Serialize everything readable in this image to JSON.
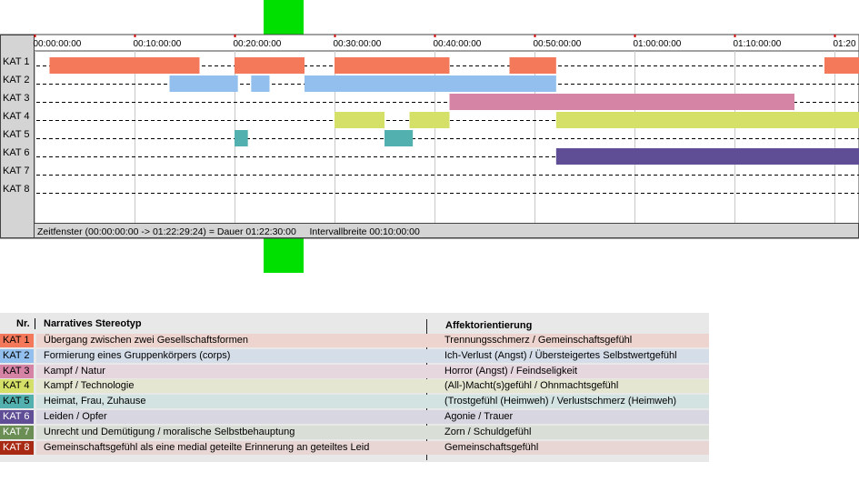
{
  "chart_data": {
    "type": "gantt",
    "x_unit": "seconds",
    "x_range": [
      0,
      4950
    ],
    "tick_interval": 600,
    "tick_labels": [
      "00:00:00:00",
      "00:10:00:00",
      "00:20:00:00",
      "00:30:00:00",
      "00:40:00:00",
      "00:50:00:00",
      "01:00:00:00",
      "01:10:00:00",
      "01:20"
    ],
    "categories": [
      "KAT 1",
      "KAT 2",
      "KAT 3",
      "KAT 4",
      "KAT 5",
      "KAT 6",
      "KAT 7",
      "KAT 8"
    ],
    "colors": [
      "#f4795a",
      "#92bfee",
      "#d584a6",
      "#d4e067",
      "#52b0ae",
      "#5f4e96",
      "#6b8e55",
      "#a82a14"
    ],
    "series": [
      {
        "category": "KAT 1",
        "segments": [
          [
            90,
            990
          ],
          [
            1200,
            1620
          ],
          [
            1800,
            2490
          ],
          [
            2850,
            3130
          ],
          [
            4740,
            4950
          ]
        ]
      },
      {
        "category": "KAT 2",
        "segments": [
          [
            810,
            1220
          ],
          [
            1300,
            1410
          ],
          [
            1620,
            3130
          ]
        ]
      },
      {
        "category": "KAT 3",
        "segments": [
          [
            2490,
            4560
          ]
        ]
      },
      {
        "category": "KAT 4",
        "segments": [
          [
            1800,
            2100
          ],
          [
            2250,
            2490
          ],
          [
            3130,
            4950
          ]
        ]
      },
      {
        "category": "KAT 5",
        "segments": [
          [
            1200,
            1280
          ],
          [
            2100,
            2270
          ]
        ]
      },
      {
        "category": "KAT 6",
        "segments": [
          [
            3130,
            4950
          ]
        ]
      },
      {
        "category": "KAT 7",
        "segments": []
      },
      {
        "category": "KAT 8",
        "segments": []
      }
    ],
    "status_text": "Zeitfenster (00:00:00:00 -> 01:22:29:24) = Dauer 01:22:30:00     Intervallbreite 00:10:00:00"
  },
  "legend": {
    "header_nr": "Nr.",
    "header_stereotyp": "Narratives Stereotyp",
    "header_affekt": "Affektorientierung",
    "rows": [
      {
        "code": "KAT 1",
        "color": "#f4795a",
        "rowbg": "#eed4ce",
        "stereotyp": "Übergang zwischen zwei Gesellschaftsformen",
        "affekt": "Trennungsschmerz / Gemeinschaftsgefühl"
      },
      {
        "code": "KAT 2",
        "color": "#92bfee",
        "rowbg": "#d5dde8",
        "stereotyp": "Formierung eines Gruppenkörpers (corps)",
        "affekt": "Ich-Verlust (Angst) / Übersteigertes Selbstwertgefühl"
      },
      {
        "code": "KAT 3",
        "color": "#d584a6",
        "rowbg": "#e6d6dd",
        "stereotyp": "Kampf / Natur",
        "affekt": "Horror (Angst) / Feindseligkeit"
      },
      {
        "code": "KAT 4",
        "color": "#d4e067",
        "rowbg": "#e4e6d2",
        "stereotyp": "Kampf / Technologie",
        "affekt": "(All-)Macht(s)gefühl / Ohnmachtsgefühl"
      },
      {
        "code": "KAT 5",
        "color": "#52b0ae",
        "rowbg": "#d2e3e2",
        "stereotyp": "Heimat, Frau, Zuhause",
        "affekt": "(Trostgefühl (Heimweh) / Verlustschmerz (Heimweh)"
      },
      {
        "code": "KAT 6",
        "color": "#5f4e96",
        "rowbg": "#d8d6e0",
        "stereotyp": "Leiden / Opfer",
        "affekt": "Agonie / Trauer"
      },
      {
        "code": "KAT 7",
        "color": "#6b8e55",
        "rowbg": "#d9ded6",
        "stereotyp": "Unrecht und Demütigung / moralische Selbstbehauptung",
        "affekt": "Zorn / Schuldgefühl"
      },
      {
        "code": "KAT 8",
        "color": "#a82a14",
        "rowbg": "#e8d6d4",
        "stereotyp": "Gemeinschaftsgefühl als eine medial geteilte Erinnerung an geteiltes Leid",
        "affekt": "Gemeinschaftsgefühl"
      }
    ]
  }
}
